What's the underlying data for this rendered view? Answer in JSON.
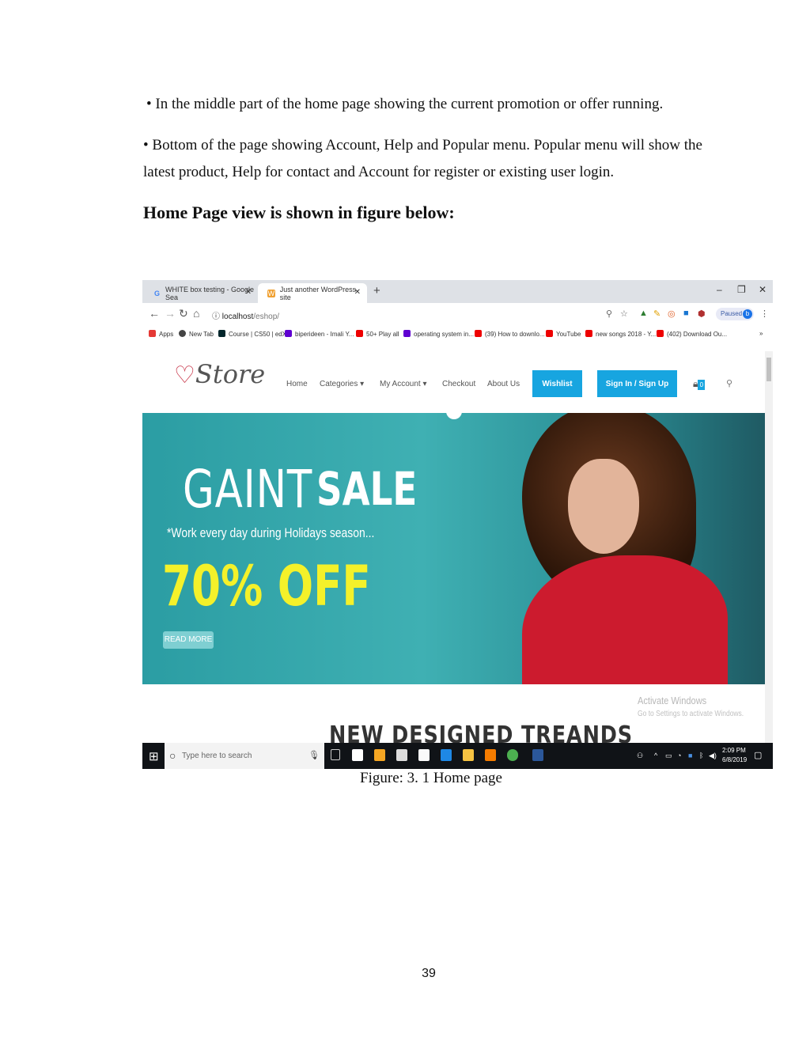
{
  "document": {
    "para1": "• In the middle part of the home page showing the current promotion or offer running.",
    "para2": "• Bottom of the page showing Account, Help and Popular menu. Popular menu will show the latest product, Help for contact and Account for register or existing user login.",
    "heading": "Home Page view is shown in figure below:",
    "caption": "Figure: 3. 1 Home page",
    "page_number": "39"
  },
  "browser": {
    "tabs": [
      {
        "label": "WHITE box testing - Google Sea",
        "icon": "google-icon"
      },
      {
        "label": "Just another WordPress site",
        "icon": "wordpress-icon"
      }
    ],
    "url_host": "localhost",
    "url_path": "/eshop/",
    "profile_status": "Paused",
    "profile_initial": "b",
    "bookmarks": [
      "Apps",
      "New Tab",
      "Course | CS50 | edX",
      "biperideen - Imali Y...",
      "50+ Play all",
      "operating system in...",
      "(39) How to downlo...",
      "YouTube",
      "new songs 2018 - Y...",
      "(402) Download Ou..."
    ]
  },
  "site": {
    "logo": "Store",
    "nav": [
      "Home",
      "Categories",
      "My Account",
      "Checkout",
      "About Us"
    ],
    "wishlist_label": "Wishlist",
    "signin_label": "Sign In / Sign Up",
    "cart_count": "0",
    "hero": {
      "title_light": "GAINT",
      "title_bold": "SALE",
      "subtitle": "*Work every day during Holidays season...",
      "offer": "70% OFF",
      "cta": "READ MORE"
    },
    "section_title": "NEW DESIGNED TREANDS"
  },
  "windows": {
    "activate_title": "Activate Windows",
    "activate_sub": "Go to Settings to activate Windows.",
    "search_placeholder": "Type here to search",
    "time": "2:09 PM",
    "date": "6/8/2019"
  },
  "colors": {
    "accent_blue": "#17a5e0",
    "hero_teal": "#2b9da3",
    "offer_yellow": "#f4f12a",
    "taskbar": "#101317"
  }
}
